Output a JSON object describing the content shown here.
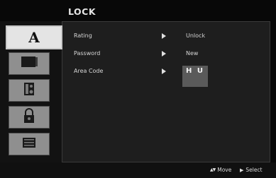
{
  "title": "LOCK",
  "tabs": [
    {
      "icon": "disc-icon",
      "glyph": "A",
      "active": true
    },
    {
      "icon": "tv-icon"
    },
    {
      "icon": "speaker-icon"
    },
    {
      "icon": "padlock-icon"
    },
    {
      "icon": "others-icon"
    }
  ],
  "rows": [
    {
      "label": "Rating",
      "value": "Unlock"
    },
    {
      "label": "Password",
      "value": "New"
    },
    {
      "label": "Area Code",
      "value": "H U"
    }
  ],
  "footer": {
    "move_glyph": "▲▼",
    "move_label": "Move",
    "select_glyph": "▶",
    "select_label": "Select"
  }
}
